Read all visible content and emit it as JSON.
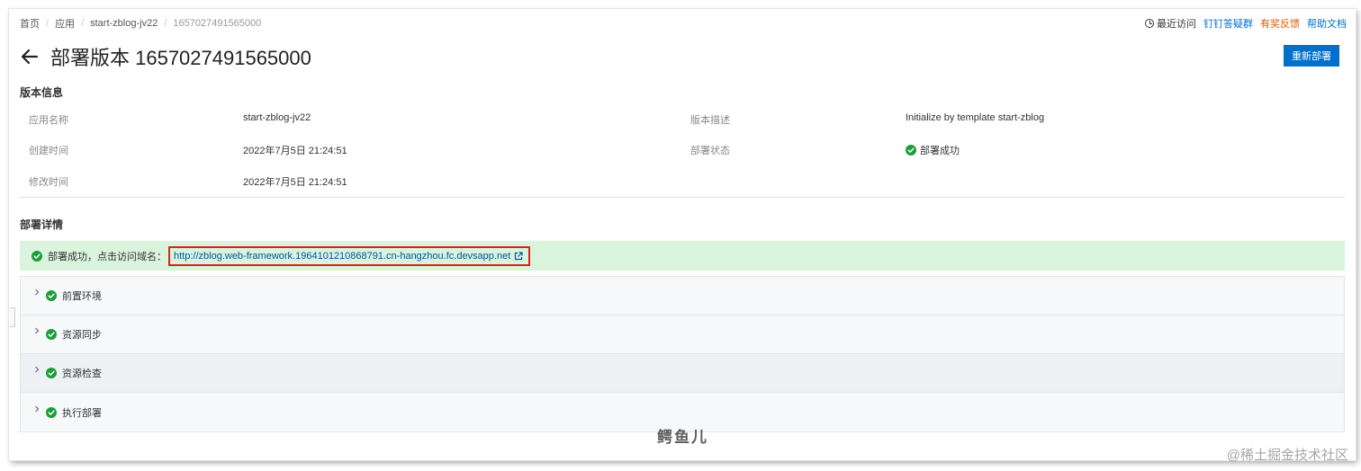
{
  "breadcrumb": [
    "首页",
    "应用",
    "start-zblog-jv22",
    "1657027491565000"
  ],
  "toplinks": {
    "recent": "最近访问",
    "dingding": "钉钉答疑群",
    "feedback": "有奖反馈",
    "help": "帮助文档"
  },
  "page": {
    "title": "部署版本 1657027491565000",
    "redeploy": "重新部署"
  },
  "version_info": {
    "section_title": "版本信息",
    "app_name_label": "应用名称",
    "app_name": "start-zblog-jv22",
    "created_label": "创建时间",
    "created": "2022年7月5日 21:24:51",
    "modified_label": "修改时间",
    "modified": "2022年7月5日 21:24:51",
    "desc_label": "版本描述",
    "desc": "Initialize by template start-zblog",
    "status_label": "部署状态",
    "status": "部署成功"
  },
  "deploy_details": {
    "section_title": "部署详情",
    "banner_text": "部署成功，点击访问域名：",
    "url": "http://zblog.web-framework.1964101210868791.cn-hangzhou.fc.devsapp.net",
    "steps": [
      {
        "label": "前置环境"
      },
      {
        "label": "资源同步"
      },
      {
        "label": "资源检查"
      },
      {
        "label": "执行部署"
      }
    ]
  },
  "watermarks": {
    "center": "鳄鱼儿",
    "corner": "@稀土掘金技术社区"
  },
  "colors": {
    "primary": "#0070cc",
    "success": "#1a9e3a",
    "banner_bg": "#d9f3dc",
    "highlight_border": "#d9231c",
    "feedback": "#e05a00"
  }
}
